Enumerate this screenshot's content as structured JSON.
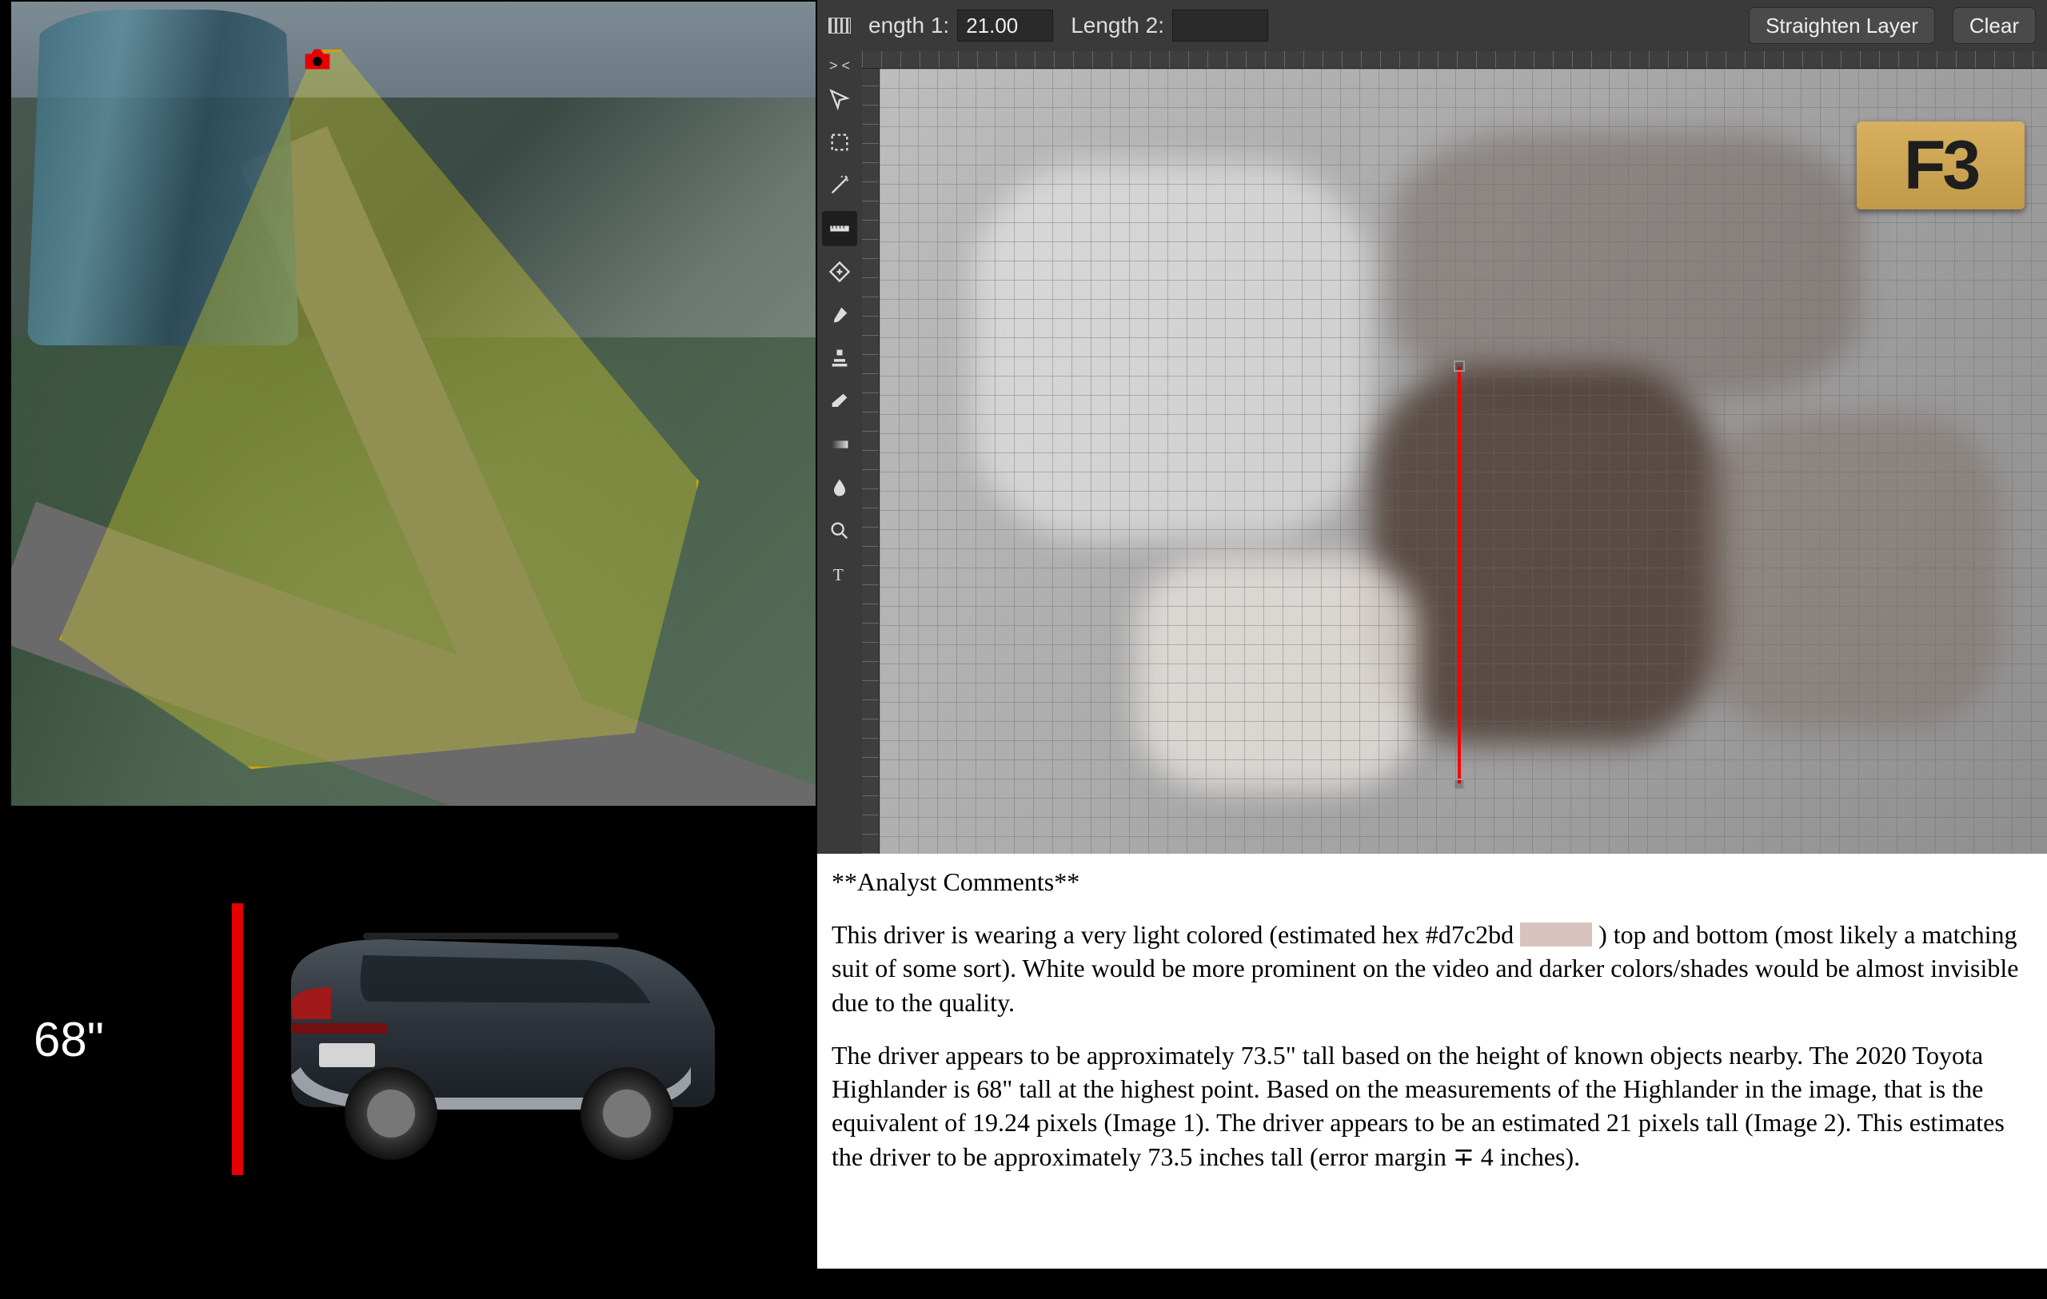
{
  "colors": {
    "accent_red": "#e60000",
    "editor_bg": "#3a3a3a",
    "swatch_hex": "#d7c2bd"
  },
  "aerial": {
    "marker_name": "camera-marker-icon"
  },
  "car": {
    "height_label": "68\""
  },
  "editor": {
    "toolbar": {
      "length1_label": "ength 1:",
      "length1_value": "21.00",
      "length2_label": "Length 2:",
      "length2_value": "",
      "straighten_label": "Straighten Layer",
      "clear_label": "Clear"
    },
    "logo_text": "F3",
    "tools": [
      "move-tool-icon",
      "marquee-tool-icon",
      "wand-tool-icon",
      "ruler-tool-icon",
      "healing-brush-icon",
      "brush-tool-icon",
      "stamp-tool-icon",
      "eraser-tool-icon",
      "gradient-tool-icon",
      "blur-tool-icon",
      "zoom-tool-icon",
      "text-tool-icon"
    ],
    "active_tool_index": 3
  },
  "notes": {
    "header": "**Analyst Comments**",
    "p1a": "This driver is wearing a very light colored (estimated hex #d7c2bd ",
    "p1b": ") top and bottom (most likely a matching suit of some sort). White would be more prominent on the video and darker colors/shades would be almost invisible due to the quality.",
    "p2": "The driver appears to be approximately 73.5\" tall based on the height of known objects nearby. The 2020 Toyota Highlander is 68\" tall at the highest point. Based on the measurements of the Highlander in the image, that is the equivalent of 19.24 pixels (Image 1). The driver appears to be an estimated 21 pixels tall (Image 2). This estimates the driver to be approximately 73.5 inches tall (error margin ∓ 4 inches)."
  }
}
